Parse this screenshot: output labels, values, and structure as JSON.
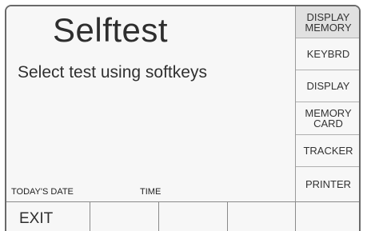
{
  "screen": {
    "title": "Selftest",
    "instruction": "Select test using softkeys",
    "date_label": "TODAY'S DATE",
    "time_label": "TIME"
  },
  "softkeys": [
    {
      "line1": "DISPLAY",
      "line2": "MEMORY",
      "active": true
    },
    {
      "line1": "KEYBRD",
      "line2": ""
    },
    {
      "line1": "DISPLAY",
      "line2": ""
    },
    {
      "line1": "MEMORY",
      "line2": "CARD"
    },
    {
      "line1": "TRACKER",
      "line2": ""
    },
    {
      "line1": "PRINTER",
      "line2": ""
    }
  ],
  "bottom_keys": [
    {
      "label": "EXIT"
    },
    {
      "label": ""
    },
    {
      "label": ""
    },
    {
      "label": ""
    },
    {
      "label": ""
    }
  ],
  "colors": {
    "background": "#f7f7f7",
    "active_softkey": "#e1e1e1",
    "border": "#6a6a6a",
    "text": "#333333"
  }
}
